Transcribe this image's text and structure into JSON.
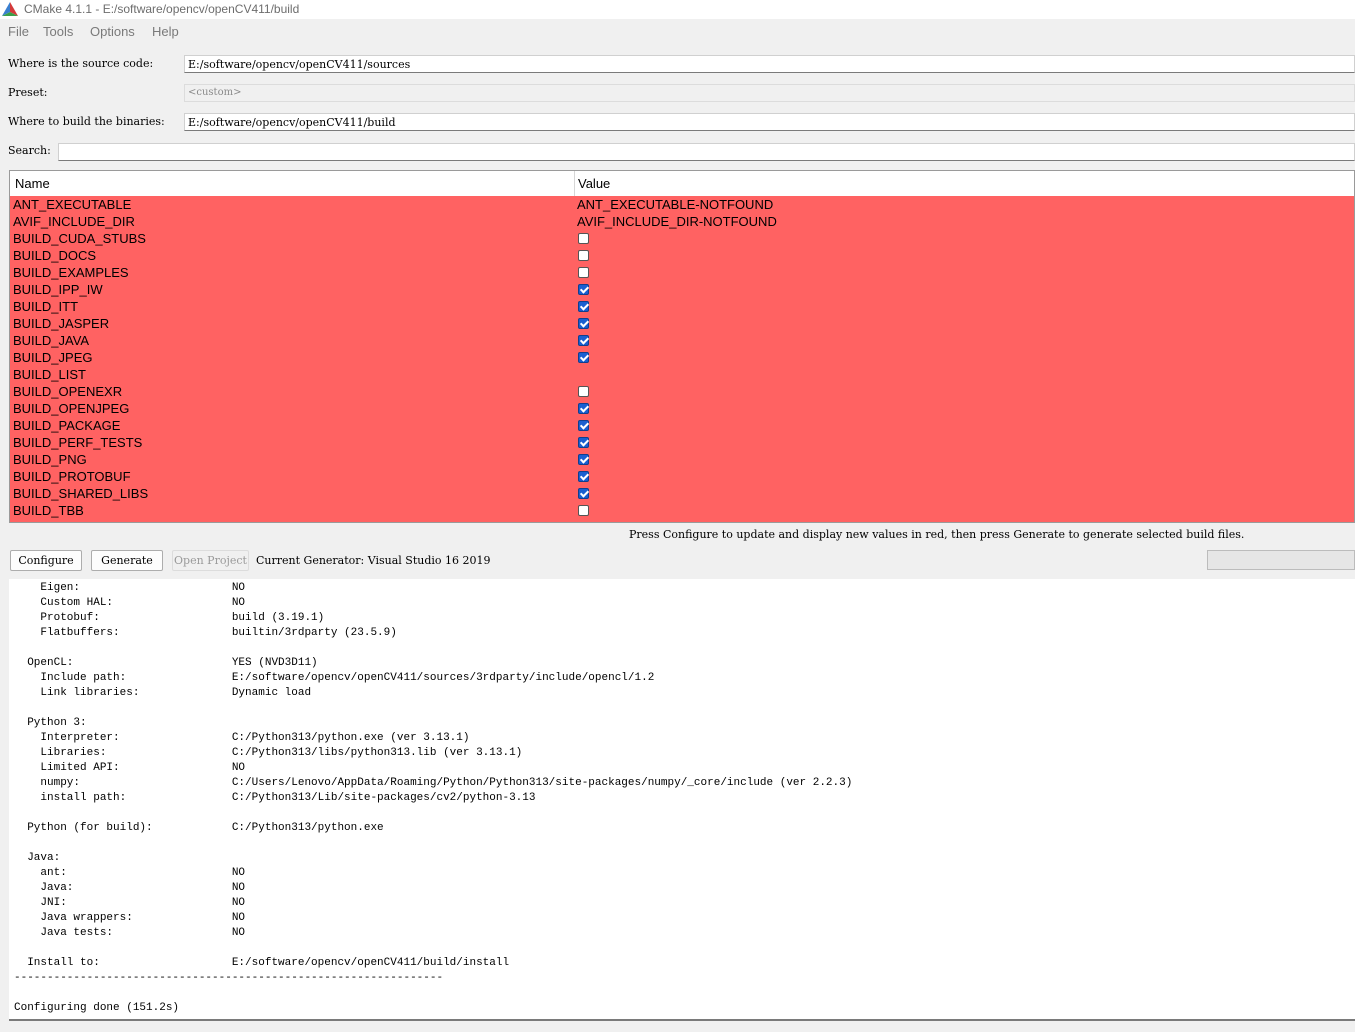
{
  "window": {
    "title": "CMake 4.1.1 - E:/software/opencv/openCV411/build"
  },
  "menu": [
    "File",
    "Tools",
    "Options",
    "Help"
  ],
  "form": {
    "source_label": "Where is the source code:",
    "source_value": "E:/software/opencv/openCV411/sources",
    "preset_label": "Preset:",
    "preset_value": "<custom>",
    "binaries_label": "Where to build the binaries:",
    "binaries_value": "E:/software/opencv/openCV411/build",
    "search_label": "Search:",
    "search_value": ""
  },
  "table": {
    "headers": {
      "name": "Name",
      "value": "Value"
    },
    "row_color": "#ff6262",
    "rows": [
      {
        "name": "ANT_EXECUTABLE",
        "type": "text",
        "value": "ANT_EXECUTABLE-NOTFOUND"
      },
      {
        "name": "AVIF_INCLUDE_DIR",
        "type": "text",
        "value": "AVIF_INCLUDE_DIR-NOTFOUND"
      },
      {
        "name": "BUILD_CUDA_STUBS",
        "type": "bool",
        "checked": false
      },
      {
        "name": "BUILD_DOCS",
        "type": "bool",
        "checked": false
      },
      {
        "name": "BUILD_EXAMPLES",
        "type": "bool",
        "checked": false
      },
      {
        "name": "BUILD_IPP_IW",
        "type": "bool",
        "checked": true
      },
      {
        "name": "BUILD_ITT",
        "type": "bool",
        "checked": true
      },
      {
        "name": "BUILD_JASPER",
        "type": "bool",
        "checked": true
      },
      {
        "name": "BUILD_JAVA",
        "type": "bool",
        "checked": true
      },
      {
        "name": "BUILD_JPEG",
        "type": "bool",
        "checked": true
      },
      {
        "name": "BUILD_LIST",
        "type": "text",
        "value": ""
      },
      {
        "name": "BUILD_OPENEXR",
        "type": "bool",
        "checked": false
      },
      {
        "name": "BUILD_OPENJPEG",
        "type": "bool",
        "checked": true
      },
      {
        "name": "BUILD_PACKAGE",
        "type": "bool",
        "checked": true
      },
      {
        "name": "BUILD_PERF_TESTS",
        "type": "bool",
        "checked": true
      },
      {
        "name": "BUILD_PNG",
        "type": "bool",
        "checked": true
      },
      {
        "name": "BUILD_PROTOBUF",
        "type": "bool",
        "checked": true
      },
      {
        "name": "BUILD_SHARED_LIBS",
        "type": "bool",
        "checked": true
      },
      {
        "name": "BUILD_TBB",
        "type": "bool",
        "checked": false
      }
    ]
  },
  "hint": "Press Configure to update and display new values in red, then press Generate to generate selected build files.",
  "buttons": {
    "configure": "Configure",
    "generate": "Generate",
    "open_project": "Open Project"
  },
  "generator": "Current Generator: Visual Studio 16 2019",
  "output": [
    "    Eigen:                       NO",
    "    Custom HAL:                  NO",
    "    Protobuf:                    build (3.19.1)",
    "    Flatbuffers:                 builtin/3rdparty (23.5.9)",
    "",
    "  OpenCL:                        YES (NVD3D11)",
    "    Include path:                E:/software/opencv/openCV411/sources/3rdparty/include/opencl/1.2",
    "    Link libraries:              Dynamic load",
    "",
    "  Python 3:",
    "    Interpreter:                 C:/Python313/python.exe (ver 3.13.1)",
    "    Libraries:                   C:/Python313/libs/python313.lib (ver 3.13.1)",
    "    Limited API:                 NO",
    "    numpy:                       C:/Users/Lenovo/AppData/Roaming/Python/Python313/site-packages/numpy/_core/include (ver 2.2.3)",
    "    install path:                C:/Python313/Lib/site-packages/cv2/python-3.13",
    "",
    "  Python (for build):            C:/Python313/python.exe",
    "",
    "  Java:",
    "    ant:                         NO",
    "    Java:                        NO",
    "    JNI:                         NO",
    "    Java wrappers:               NO",
    "    Java tests:                  NO",
    "",
    "  Install to:                    E:/software/opencv/openCV411/build/install",
    "-----------------------------------------------------------------",
    "",
    "Configuring done (151.2s)"
  ]
}
